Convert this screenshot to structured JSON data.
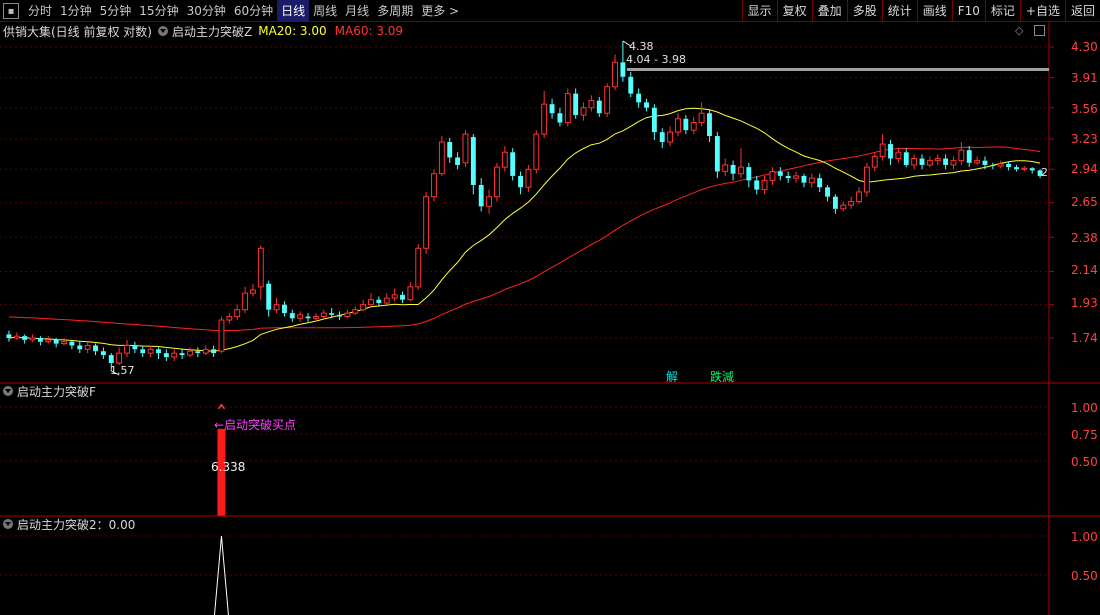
{
  "toolbar": {
    "periods": [
      "分时",
      "1分钟",
      "5分钟",
      "15分钟",
      "30分钟",
      "60分钟",
      "日线",
      "周线",
      "月线",
      "多周期",
      "更多 >"
    ],
    "active_period": "日线",
    "right_buttons": [
      "显示",
      "复权",
      "叠加",
      "多股",
      "统计",
      "画线",
      "F10",
      "标记",
      "+自选",
      "返回"
    ]
  },
  "main_panel": {
    "stock_label": "供销大集(日线 前复权 对数)",
    "indicator_name": "启动主力突破Z",
    "ma20_label": "MA20: 3.00",
    "ma60_label": "MA60: 3.09",
    "price_axis": [
      "4.30",
      "3.91",
      "3.56",
      "3.23",
      "2.94",
      "2.65",
      "2.38",
      "2.14",
      "1.93",
      "1.74"
    ],
    "low_label": "1.57",
    "high_label": "4.38",
    "range_label": "4.04 - 3.98",
    "last_mark": "2",
    "signal_jie": "解",
    "signal_diejian": "跌減"
  },
  "sub_panel_1": {
    "title": "启动主力突破F",
    "axis": [
      "1.00",
      "0.75",
      "0.50"
    ],
    "buy_text": "←启动突破买点",
    "buy_value": "6.338"
  },
  "sub_panel_2": {
    "title": "启动主力突破2：0.00",
    "axis": [
      "1.00",
      "0.50"
    ]
  },
  "colors": {
    "up": "#ff3232",
    "down": "#54ffff",
    "ma20": "#ffff33",
    "ma60": "#ff2020",
    "grid": "#5a0000"
  },
  "chart_data": {
    "type": "candlestick",
    "log_scale": true,
    "y_ticks": [
      4.3,
      3.91,
      3.56,
      3.23,
      2.94,
      2.65,
      2.38,
      2.14,
      1.93,
      1.74
    ],
    "candles": [
      [
        1.76,
        1.74,
        1.78,
        1.72
      ],
      [
        1.74,
        1.75,
        1.77,
        1.73
      ],
      [
        1.75,
        1.73,
        1.76,
        1.71
      ],
      [
        1.73,
        1.74,
        1.76,
        1.72
      ],
      [
        1.74,
        1.72,
        1.75,
        1.7
      ],
      [
        1.72,
        1.73,
        1.75,
        1.71
      ],
      [
        1.73,
        1.71,
        1.74,
        1.69
      ],
      [
        1.71,
        1.72,
        1.74,
        1.7
      ],
      [
        1.72,
        1.7,
        1.73,
        1.68
      ],
      [
        1.7,
        1.68,
        1.72,
        1.66
      ],
      [
        1.68,
        1.7,
        1.72,
        1.66
      ],
      [
        1.7,
        1.67,
        1.71,
        1.65
      ],
      [
        1.67,
        1.65,
        1.69,
        1.63
      ],
      [
        1.65,
        1.61,
        1.66,
        1.57
      ],
      [
        1.61,
        1.66,
        1.69,
        1.6
      ],
      [
        1.66,
        1.7,
        1.73,
        1.64
      ],
      [
        1.7,
        1.68,
        1.72,
        1.66
      ],
      [
        1.68,
        1.66,
        1.7,
        1.64
      ],
      [
        1.66,
        1.68,
        1.7,
        1.64
      ],
      [
        1.68,
        1.66,
        1.69,
        1.63
      ],
      [
        1.66,
        1.64,
        1.68,
        1.62
      ],
      [
        1.64,
        1.66,
        1.68,
        1.62
      ],
      [
        1.66,
        1.65,
        1.68,
        1.63
      ],
      [
        1.65,
        1.67,
        1.69,
        1.64
      ],
      [
        1.67,
        1.66,
        1.69,
        1.64
      ],
      [
        1.66,
        1.68,
        1.7,
        1.65
      ],
      [
        1.68,
        1.66,
        1.7,
        1.64
      ],
      [
        1.67,
        1.84,
        1.86,
        1.66
      ],
      [
        1.84,
        1.86,
        1.88,
        1.82
      ],
      [
        1.86,
        1.9,
        1.93,
        1.84
      ],
      [
        1.9,
        2.0,
        2.04,
        1.88
      ],
      [
        2.0,
        2.02,
        2.06,
        1.98
      ],
      [
        2.04,
        2.3,
        2.32,
        1.96
      ],
      [
        2.06,
        1.9,
        2.08,
        1.86
      ],
      [
        1.9,
        1.93,
        1.97,
        1.88
      ],
      [
        1.93,
        1.88,
        1.95,
        1.86
      ],
      [
        1.88,
        1.85,
        1.9,
        1.83
      ],
      [
        1.85,
        1.87,
        1.89,
        1.83
      ],
      [
        1.86,
        1.85,
        1.88,
        1.83
      ],
      [
        1.85,
        1.86,
        1.88,
        1.83
      ],
      [
        1.86,
        1.88,
        1.9,
        1.84
      ],
      [
        1.88,
        1.87,
        1.91,
        1.85
      ],
      [
        1.87,
        1.86,
        1.89,
        1.84
      ],
      [
        1.86,
        1.88,
        1.9,
        1.85
      ],
      [
        1.88,
        1.9,
        1.92,
        1.87
      ],
      [
        1.9,
        1.93,
        1.96,
        1.89
      ],
      [
        1.93,
        1.96,
        2.0,
        1.91
      ],
      [
        1.96,
        1.94,
        1.98,
        1.92
      ],
      [
        1.94,
        1.97,
        2.0,
        1.93
      ],
      [
        1.97,
        1.99,
        2.03,
        1.95
      ],
      [
        1.99,
        1.96,
        2.01,
        1.94
      ],
      [
        1.96,
        2.04,
        2.07,
        1.95
      ],
      [
        2.04,
        2.3,
        2.33,
        2.02
      ],
      [
        2.3,
        2.7,
        2.74,
        2.26
      ],
      [
        2.7,
        2.9,
        2.94,
        2.66
      ],
      [
        2.9,
        3.2,
        3.26,
        2.88
      ],
      [
        3.2,
        3.05,
        3.24,
        3.0
      ],
      [
        3.05,
        2.98,
        3.1,
        2.94
      ],
      [
        3.0,
        3.28,
        3.32,
        2.96
      ],
      [
        3.25,
        2.8,
        3.28,
        2.72
      ],
      [
        2.8,
        2.62,
        2.86,
        2.58
      ],
      [
        2.62,
        2.7,
        2.76,
        2.56
      ],
      [
        2.7,
        2.96,
        3.0,
        2.66
      ],
      [
        2.96,
        3.1,
        3.16,
        2.92
      ],
      [
        3.1,
        2.88,
        3.14,
        2.84
      ],
      [
        2.88,
        2.78,
        2.92,
        2.72
      ],
      [
        2.78,
        2.94,
        2.98,
        2.74
      ],
      [
        2.94,
        3.28,
        3.32,
        2.9
      ],
      [
        3.28,
        3.6,
        3.75,
        3.24
      ],
      [
        3.6,
        3.5,
        3.66,
        3.44
      ],
      [
        3.5,
        3.4,
        3.56,
        3.36
      ],
      [
        3.4,
        3.72,
        3.78,
        3.36
      ],
      [
        3.72,
        3.48,
        3.78,
        3.44
      ],
      [
        3.48,
        3.56,
        3.62,
        3.42
      ],
      [
        3.56,
        3.64,
        3.7,
        3.52
      ],
      [
        3.64,
        3.5,
        3.68,
        3.46
      ],
      [
        3.5,
        3.8,
        3.84,
        3.46
      ],
      [
        3.8,
        4.1,
        4.2,
        3.76
      ],
      [
        4.1,
        3.92,
        4.38,
        3.86
      ],
      [
        3.92,
        3.72,
        3.98,
        3.68
      ],
      [
        3.72,
        3.62,
        3.78,
        3.56
      ],
      [
        3.62,
        3.56,
        3.66,
        3.52
      ],
      [
        3.56,
        3.3,
        3.6,
        3.22
      ],
      [
        3.3,
        3.2,
        3.34,
        3.14
      ],
      [
        3.2,
        3.3,
        3.36,
        3.16
      ],
      [
        3.3,
        3.44,
        3.5,
        3.26
      ],
      [
        3.44,
        3.32,
        3.48,
        3.28
      ],
      [
        3.32,
        3.4,
        3.46,
        3.28
      ],
      [
        3.4,
        3.5,
        3.62,
        3.36
      ],
      [
        3.5,
        3.26,
        3.54,
        3.2
      ],
      [
        3.26,
        2.92,
        3.3,
        2.86
      ],
      [
        2.92,
        2.98,
        3.04,
        2.88
      ],
      [
        2.98,
        2.9,
        3.02,
        2.84
      ],
      [
        2.9,
        2.96,
        3.14,
        2.86
      ],
      [
        2.96,
        2.84,
        3.0,
        2.78
      ],
      [
        2.84,
        2.76,
        2.88,
        2.72
      ],
      [
        2.76,
        2.84,
        2.88,
        2.72
      ],
      [
        2.84,
        2.92,
        2.96,
        2.8
      ],
      [
        2.92,
        2.88,
        2.96,
        2.84
      ],
      [
        2.88,
        2.86,
        2.92,
        2.82
      ],
      [
        2.86,
        2.88,
        2.92,
        2.82
      ],
      [
        2.88,
        2.82,
        2.9,
        2.78
      ],
      [
        2.82,
        2.86,
        2.9,
        2.78
      ],
      [
        2.86,
        2.78,
        2.9,
        2.74
      ],
      [
        2.78,
        2.7,
        2.8,
        2.66
      ],
      [
        2.7,
        2.6,
        2.72,
        2.56
      ],
      [
        2.6,
        2.63,
        2.66,
        2.58
      ],
      [
        2.63,
        2.66,
        2.7,
        2.6
      ],
      [
        2.66,
        2.74,
        2.78,
        2.64
      ],
      [
        2.74,
        2.96,
        3.0,
        2.7
      ],
      [
        2.96,
        3.06,
        3.1,
        2.92
      ],
      [
        3.06,
        3.18,
        3.28,
        3.02
      ],
      [
        3.18,
        3.04,
        3.22,
        2.98
      ],
      [
        3.04,
        3.1,
        3.14,
        3.0
      ],
      [
        3.1,
        2.98,
        3.14,
        2.96
      ],
      [
        2.98,
        3.04,
        3.08,
        2.94
      ],
      [
        3.04,
        2.98,
        3.08,
        2.94
      ],
      [
        2.98,
        3.02,
        3.06,
        2.96
      ],
      [
        3.02,
        3.04,
        3.08,
        2.98
      ],
      [
        3.04,
        2.98,
        3.08,
        2.94
      ],
      [
        2.98,
        3.02,
        3.06,
        2.94
      ],
      [
        3.02,
        3.12,
        3.2,
        2.98
      ],
      [
        3.12,
        3.0,
        3.16,
        2.96
      ],
      [
        3.0,
        3.02,
        3.06,
        2.98
      ],
      [
        3.02,
        2.98,
        3.06,
        2.94
      ],
      [
        2.98,
        2.97,
        3.0,
        2.94
      ],
      [
        2.97,
        2.99,
        3.02,
        2.95
      ],
      [
        2.99,
        2.96,
        3.01,
        2.93
      ],
      [
        2.96,
        2.94,
        2.98,
        2.92
      ],
      [
        2.94,
        2.95,
        2.97,
        2.92
      ],
      [
        2.95,
        2.93,
        2.96,
        2.9
      ],
      [
        2.93,
        2.88,
        2.94,
        2.86
      ]
    ],
    "sub1": {
      "signal_index": 27,
      "values": [
        0,
        1
      ]
    },
    "sub2": {
      "signal_index": 27,
      "values": [
        0,
        1
      ]
    }
  }
}
